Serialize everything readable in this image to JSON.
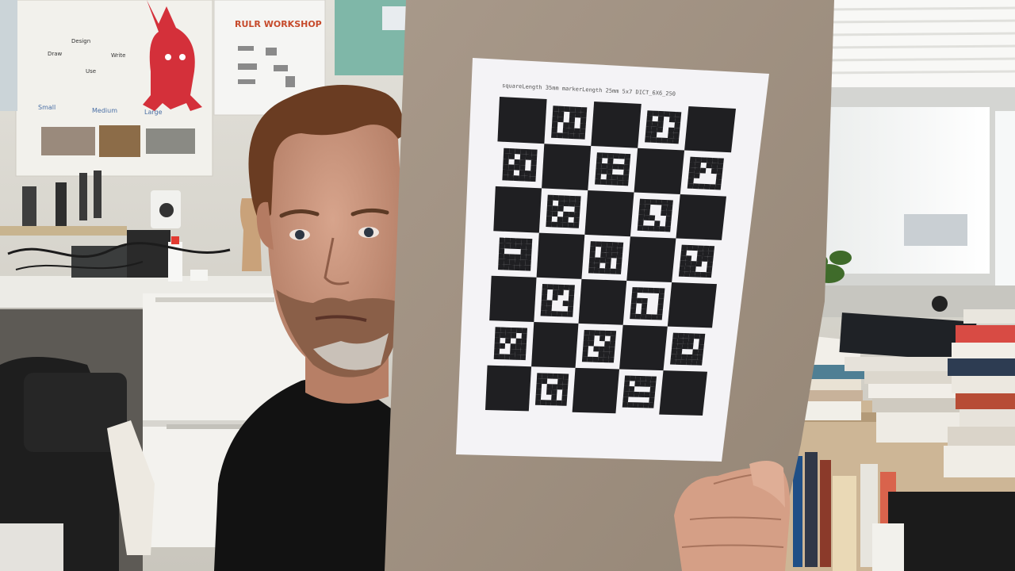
{
  "scene": {
    "description_kind": "webcam-photo",
    "subject": "person holding calibration board"
  },
  "posters": {
    "workshop_title": "RULR WORKSHOP",
    "left_captions": [
      "Design",
      "Draw",
      "Write",
      "Use"
    ],
    "size_labels": [
      "Small",
      "Medium",
      "Large"
    ]
  },
  "board": {
    "header_text": "squareLength 35mm markerLength 25mm 5x7 DICT_6X6_250",
    "rows": 7,
    "cols": 5
  },
  "colors": {
    "wall": "#d9d7cf",
    "board": "#a39381",
    "paper": "#f4f3f6",
    "square": "#1f1f22",
    "window": "#eef0f0",
    "shirt": "#121212"
  }
}
